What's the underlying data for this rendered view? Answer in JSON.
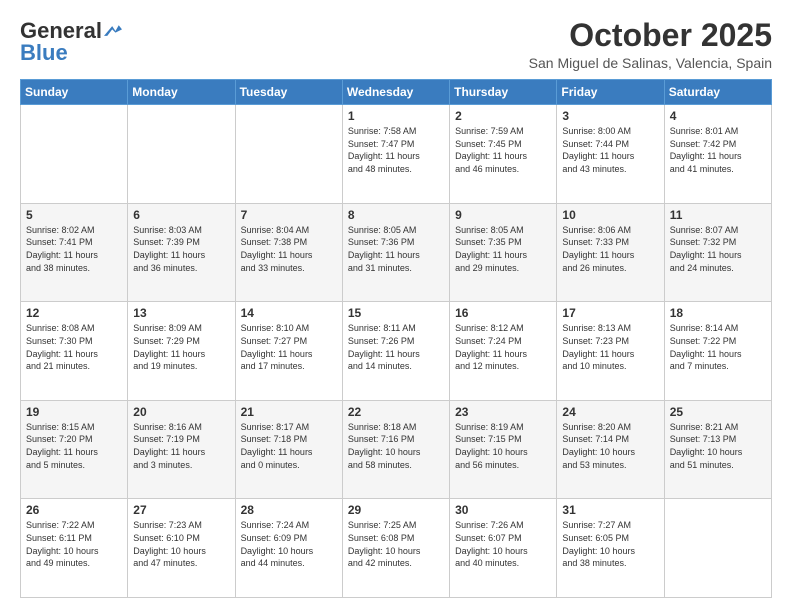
{
  "header": {
    "logo_general": "General",
    "logo_blue": "Blue",
    "month": "October 2025",
    "location": "San Miguel de Salinas, Valencia, Spain"
  },
  "weekdays": [
    "Sunday",
    "Monday",
    "Tuesday",
    "Wednesday",
    "Thursday",
    "Friday",
    "Saturday"
  ],
  "weeks": [
    [
      {
        "day": "",
        "info": ""
      },
      {
        "day": "",
        "info": ""
      },
      {
        "day": "",
        "info": ""
      },
      {
        "day": "1",
        "info": "Sunrise: 7:58 AM\nSunset: 7:47 PM\nDaylight: 11 hours\nand 48 minutes."
      },
      {
        "day": "2",
        "info": "Sunrise: 7:59 AM\nSunset: 7:45 PM\nDaylight: 11 hours\nand 46 minutes."
      },
      {
        "day": "3",
        "info": "Sunrise: 8:00 AM\nSunset: 7:44 PM\nDaylight: 11 hours\nand 43 minutes."
      },
      {
        "day": "4",
        "info": "Sunrise: 8:01 AM\nSunset: 7:42 PM\nDaylight: 11 hours\nand 41 minutes."
      }
    ],
    [
      {
        "day": "5",
        "info": "Sunrise: 8:02 AM\nSunset: 7:41 PM\nDaylight: 11 hours\nand 38 minutes."
      },
      {
        "day": "6",
        "info": "Sunrise: 8:03 AM\nSunset: 7:39 PM\nDaylight: 11 hours\nand 36 minutes."
      },
      {
        "day": "7",
        "info": "Sunrise: 8:04 AM\nSunset: 7:38 PM\nDaylight: 11 hours\nand 33 minutes."
      },
      {
        "day": "8",
        "info": "Sunrise: 8:05 AM\nSunset: 7:36 PM\nDaylight: 11 hours\nand 31 minutes."
      },
      {
        "day": "9",
        "info": "Sunrise: 8:05 AM\nSunset: 7:35 PM\nDaylight: 11 hours\nand 29 minutes."
      },
      {
        "day": "10",
        "info": "Sunrise: 8:06 AM\nSunset: 7:33 PM\nDaylight: 11 hours\nand 26 minutes."
      },
      {
        "day": "11",
        "info": "Sunrise: 8:07 AM\nSunset: 7:32 PM\nDaylight: 11 hours\nand 24 minutes."
      }
    ],
    [
      {
        "day": "12",
        "info": "Sunrise: 8:08 AM\nSunset: 7:30 PM\nDaylight: 11 hours\nand 21 minutes."
      },
      {
        "day": "13",
        "info": "Sunrise: 8:09 AM\nSunset: 7:29 PM\nDaylight: 11 hours\nand 19 minutes."
      },
      {
        "day": "14",
        "info": "Sunrise: 8:10 AM\nSunset: 7:27 PM\nDaylight: 11 hours\nand 17 minutes."
      },
      {
        "day": "15",
        "info": "Sunrise: 8:11 AM\nSunset: 7:26 PM\nDaylight: 11 hours\nand 14 minutes."
      },
      {
        "day": "16",
        "info": "Sunrise: 8:12 AM\nSunset: 7:24 PM\nDaylight: 11 hours\nand 12 minutes."
      },
      {
        "day": "17",
        "info": "Sunrise: 8:13 AM\nSunset: 7:23 PM\nDaylight: 11 hours\nand 10 minutes."
      },
      {
        "day": "18",
        "info": "Sunrise: 8:14 AM\nSunset: 7:22 PM\nDaylight: 11 hours\nand 7 minutes."
      }
    ],
    [
      {
        "day": "19",
        "info": "Sunrise: 8:15 AM\nSunset: 7:20 PM\nDaylight: 11 hours\nand 5 minutes."
      },
      {
        "day": "20",
        "info": "Sunrise: 8:16 AM\nSunset: 7:19 PM\nDaylight: 11 hours\nand 3 minutes."
      },
      {
        "day": "21",
        "info": "Sunrise: 8:17 AM\nSunset: 7:18 PM\nDaylight: 11 hours\nand 0 minutes."
      },
      {
        "day": "22",
        "info": "Sunrise: 8:18 AM\nSunset: 7:16 PM\nDaylight: 10 hours\nand 58 minutes."
      },
      {
        "day": "23",
        "info": "Sunrise: 8:19 AM\nSunset: 7:15 PM\nDaylight: 10 hours\nand 56 minutes."
      },
      {
        "day": "24",
        "info": "Sunrise: 8:20 AM\nSunset: 7:14 PM\nDaylight: 10 hours\nand 53 minutes."
      },
      {
        "day": "25",
        "info": "Sunrise: 8:21 AM\nSunset: 7:13 PM\nDaylight: 10 hours\nand 51 minutes."
      }
    ],
    [
      {
        "day": "26",
        "info": "Sunrise: 7:22 AM\nSunset: 6:11 PM\nDaylight: 10 hours\nand 49 minutes."
      },
      {
        "day": "27",
        "info": "Sunrise: 7:23 AM\nSunset: 6:10 PM\nDaylight: 10 hours\nand 47 minutes."
      },
      {
        "day": "28",
        "info": "Sunrise: 7:24 AM\nSunset: 6:09 PM\nDaylight: 10 hours\nand 44 minutes."
      },
      {
        "day": "29",
        "info": "Sunrise: 7:25 AM\nSunset: 6:08 PM\nDaylight: 10 hours\nand 42 minutes."
      },
      {
        "day": "30",
        "info": "Sunrise: 7:26 AM\nSunset: 6:07 PM\nDaylight: 10 hours\nand 40 minutes."
      },
      {
        "day": "31",
        "info": "Sunrise: 7:27 AM\nSunset: 6:05 PM\nDaylight: 10 hours\nand 38 minutes."
      },
      {
        "day": "",
        "info": ""
      }
    ]
  ]
}
